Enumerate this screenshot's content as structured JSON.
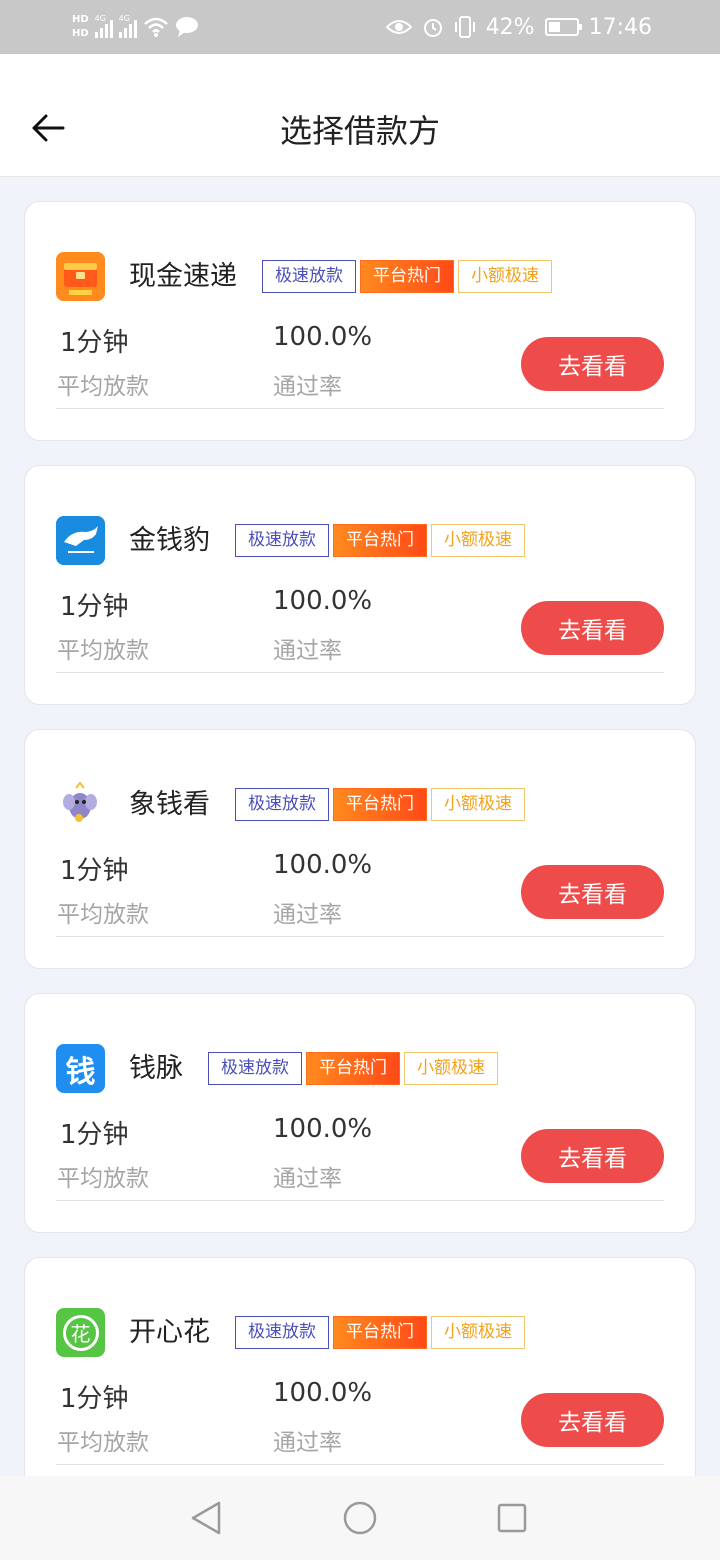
{
  "status_bar": {
    "hd_top": "HD",
    "hd_bottom": "HD",
    "signal1": "4G",
    "signal2": "4G",
    "battery": "42%",
    "time": "17:46",
    "battery_level": 0.42
  },
  "header": {
    "title": "选择借款方"
  },
  "tags": {
    "speed": "极速放款",
    "hot": "平台热门",
    "small": "小额极速"
  },
  "lenders": [
    {
      "name": "现金速递",
      "logo": "treasure-box-logo",
      "logo_color": "#ff8a1e",
      "time_value": "1分钟",
      "time_label": "平均放款",
      "rate_value": "100.0%",
      "rate_label": "通过率",
      "button": "去看看"
    },
    {
      "name": "金钱豹",
      "logo": "leopard-logo",
      "logo_color": "#1a8ce0",
      "time_value": "1分钟",
      "time_label": "平均放款",
      "rate_value": "100.0%",
      "rate_label": "通过率",
      "button": "去看看"
    },
    {
      "name": "象钱看",
      "logo": "elephant-logo",
      "logo_color": "#8f86c9",
      "time_value": "1分钟",
      "time_label": "平均放款",
      "rate_value": "100.0%",
      "rate_label": "通过率",
      "button": "去看看"
    },
    {
      "name": "钱脉",
      "logo": "qian-logo",
      "logo_color": "#1f8ef0",
      "logo_text": "钱",
      "time_value": "1分钟",
      "time_label": "平均放款",
      "rate_value": "100.0%",
      "rate_label": "通过率",
      "button": "去看看"
    },
    {
      "name": "开心花",
      "logo": "flower-logo",
      "logo_color": "#56c543",
      "logo_text": "花",
      "time_value": "1分钟",
      "time_label": "平均放款",
      "rate_value": "100.0%",
      "rate_label": "通过率",
      "button": "去看看"
    }
  ],
  "nav": {
    "back": "triangle-back-icon",
    "home": "circle-home-icon",
    "recent": "square-recent-icon"
  }
}
